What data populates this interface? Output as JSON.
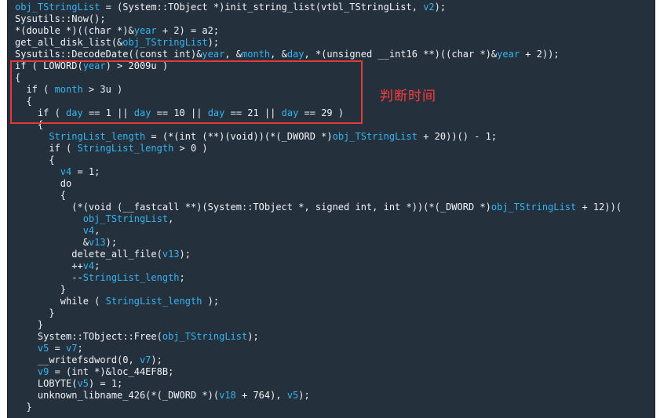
{
  "annotation": {
    "label": "判断时间",
    "color": "#e53a3a"
  },
  "colors": {
    "background": "#25303d",
    "text": "#e4e8ee",
    "variable": "#34b4f0"
  },
  "code_lines": [
    [
      [
        "v",
        "obj_TStringList"
      ],
      [
        "t",
        " = (System::TObject *)init_string_list(vtbl_TStringList, "
      ],
      [
        "v",
        "v2"
      ],
      [
        "t",
        ");"
      ]
    ],
    [
      [
        "t",
        "Sysutils::Now();"
      ]
    ],
    [
      [
        "t",
        "*(double *)((char *)&"
      ],
      [
        "v",
        "year"
      ],
      [
        "t",
        " + 2) = a2;"
      ]
    ],
    [
      [
        "t",
        "get_all_disk_list(&"
      ],
      [
        "v",
        "obj_TStringList"
      ],
      [
        "t",
        ");"
      ]
    ],
    [
      [
        "t",
        "Sysutils::DecodeDate((const int)&"
      ],
      [
        "v",
        "year"
      ],
      [
        "t",
        ", &"
      ],
      [
        "v",
        "month"
      ],
      [
        "t",
        ", &"
      ],
      [
        "v",
        "day"
      ],
      [
        "t",
        ", *(unsigned __int16 **)((char *)&"
      ],
      [
        "v",
        "year"
      ],
      [
        "t",
        " + 2));"
      ]
    ],
    [
      [
        "t",
        "if ( LOWORD("
      ],
      [
        "v",
        "year"
      ],
      [
        "t",
        ") > 2009u )"
      ]
    ],
    [
      [
        "t",
        "{"
      ]
    ],
    [
      [
        "t",
        "  if ( "
      ],
      [
        "v",
        "month"
      ],
      [
        "t",
        " > 3u )"
      ]
    ],
    [
      [
        "t",
        "  {"
      ]
    ],
    [
      [
        "t",
        "    if ( "
      ],
      [
        "v",
        "day"
      ],
      [
        "t",
        " == 1 || "
      ],
      [
        "v",
        "day"
      ],
      [
        "t",
        " == 10 || "
      ],
      [
        "v",
        "day"
      ],
      [
        "t",
        " == 21 || "
      ],
      [
        "v",
        "day"
      ],
      [
        "t",
        " == 29 )"
      ]
    ],
    [
      [
        "t",
        "    {"
      ]
    ],
    [
      [
        "t",
        "      "
      ],
      [
        "v",
        "StringList_length"
      ],
      [
        "t",
        " = (*(int (**)(void))(*(_DWORD *)"
      ],
      [
        "v",
        "obj_TStringList"
      ],
      [
        "t",
        " + 20))() - 1;"
      ]
    ],
    [
      [
        "t",
        "      if ( "
      ],
      [
        "v",
        "StringList_length"
      ],
      [
        "t",
        " > 0 )"
      ]
    ],
    [
      [
        "t",
        "      {"
      ]
    ],
    [
      [
        "t",
        "        "
      ],
      [
        "v",
        "v4"
      ],
      [
        "t",
        " = 1;"
      ]
    ],
    [
      [
        "t",
        "        do"
      ]
    ],
    [
      [
        "t",
        "        {"
      ]
    ],
    [
      [
        "t",
        "          (*(void (__fastcall **)(System::TObject *, signed int, int *))(*(_DWORD *)"
      ],
      [
        "v",
        "obj_TStringList"
      ],
      [
        "t",
        " + 12))("
      ]
    ],
    [
      [
        "t",
        "            "
      ],
      [
        "v",
        "obj_TStringList"
      ],
      [
        "t",
        ","
      ]
    ],
    [
      [
        "t",
        "            "
      ],
      [
        "v",
        "v4"
      ],
      [
        "t",
        ","
      ]
    ],
    [
      [
        "t",
        "            &"
      ],
      [
        "v",
        "v13"
      ],
      [
        "t",
        ");"
      ]
    ],
    [
      [
        "t",
        "          delete_all_file("
      ],
      [
        "v",
        "v13"
      ],
      [
        "t",
        ");"
      ]
    ],
    [
      [
        "t",
        "          ++"
      ],
      [
        "v",
        "v4"
      ],
      [
        "t",
        ";"
      ]
    ],
    [
      [
        "t",
        "          --"
      ],
      [
        "v",
        "StringList_length"
      ],
      [
        "t",
        ";"
      ]
    ],
    [
      [
        "t",
        "        }"
      ]
    ],
    [
      [
        "t",
        "        while ( "
      ],
      [
        "v",
        "StringList_length"
      ],
      [
        "t",
        " );"
      ]
    ],
    [
      [
        "t",
        "      }"
      ]
    ],
    [
      [
        "t",
        "    }"
      ]
    ],
    [
      [
        "t",
        "    System::TObject::Free("
      ],
      [
        "v",
        "obj_TStringList"
      ],
      [
        "t",
        ");"
      ]
    ],
    [
      [
        "t",
        "    "
      ],
      [
        "v",
        "v5"
      ],
      [
        "t",
        " = "
      ],
      [
        "v",
        "v7"
      ],
      [
        "t",
        ";"
      ]
    ],
    [
      [
        "t",
        "    __writefsdword(0, "
      ],
      [
        "v",
        "v7"
      ],
      [
        "t",
        ");"
      ]
    ],
    [
      [
        "t",
        "    "
      ],
      [
        "v",
        "v9"
      ],
      [
        "t",
        " = (int *)&loc_44EF8B;"
      ]
    ],
    [
      [
        "t",
        "    LOBYTE("
      ],
      [
        "v",
        "v5"
      ],
      [
        "t",
        ") = 1;"
      ]
    ],
    [
      [
        "t",
        "    unknown_libname_426(*(_DWORD *)("
      ],
      [
        "v",
        "v18"
      ],
      [
        "t",
        " + 764), "
      ],
      [
        "v",
        "v5"
      ],
      [
        "t",
        ");"
      ]
    ],
    [
      [
        "t",
        "  }"
      ]
    ]
  ]
}
